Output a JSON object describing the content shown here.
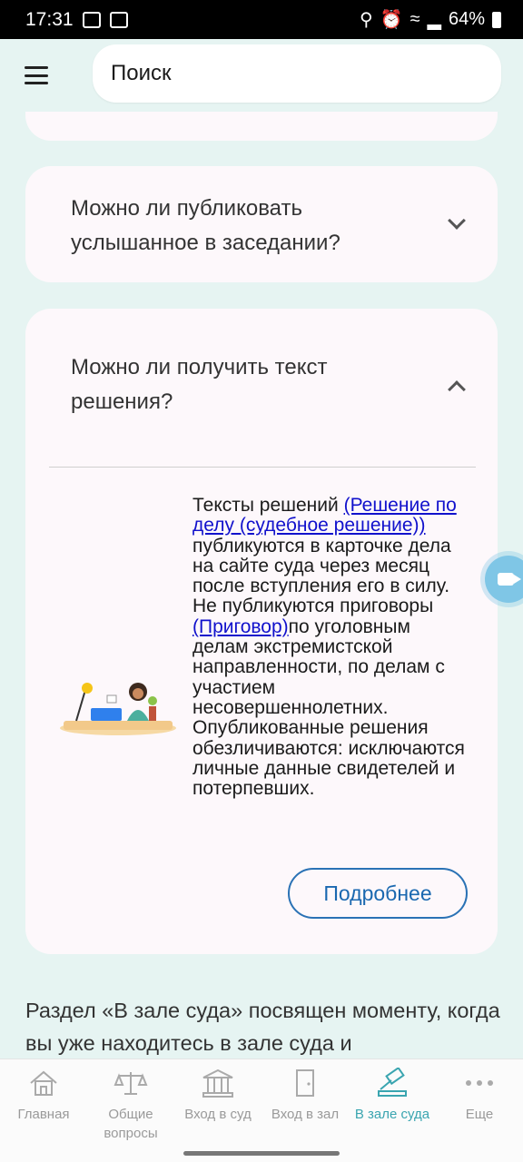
{
  "status_bar": {
    "time": "17:31",
    "battery": "64%"
  },
  "search": {
    "placeholder": "Поиск"
  },
  "faq": [
    {
      "question": "Можно ли публиковать услышанное в заседании?",
      "expanded": false
    },
    {
      "question": "Можно ли получить текст решения?",
      "expanded": true,
      "answer": {
        "t1": "Тексты решений ",
        "link1": "(Решение по делу (судебное решение))",
        "t2": " публикуются в карточке дела на сайте суда через месяц после вступления его в силу. Не публикуются приговоры ",
        "link2": "(Приговор)",
        "t3": "по уголовным делам экстремистской направленности, по делам с участием несовершеннолетних. Опубликованные решения обезличиваются: исключаются личные данные свидетелей и потерпевших."
      },
      "more_label": "Подробнее"
    }
  ],
  "section_text": "Раздел «В зале суда» посвящен моменту, когда вы уже находитесь в зале суда и",
  "bottom_nav": [
    {
      "label": "Главная",
      "icon": "home-icon",
      "active": false
    },
    {
      "label": "Общие вопросы",
      "icon": "scales-icon",
      "active": false
    },
    {
      "label": "Вход в суд",
      "icon": "courthouse-icon",
      "active": false
    },
    {
      "label": "Вход в зал",
      "icon": "door-icon",
      "active": false
    },
    {
      "label": "В зале суда",
      "icon": "gavel-icon",
      "active": true
    },
    {
      "label": "Еще",
      "icon": "more-icon",
      "active": false
    }
  ],
  "colors": {
    "accent": "#3aa5b0",
    "link": "#1111cc",
    "button_border": "#2a72b5",
    "background": "#e6f4f2",
    "card": "#fdf8fb"
  }
}
